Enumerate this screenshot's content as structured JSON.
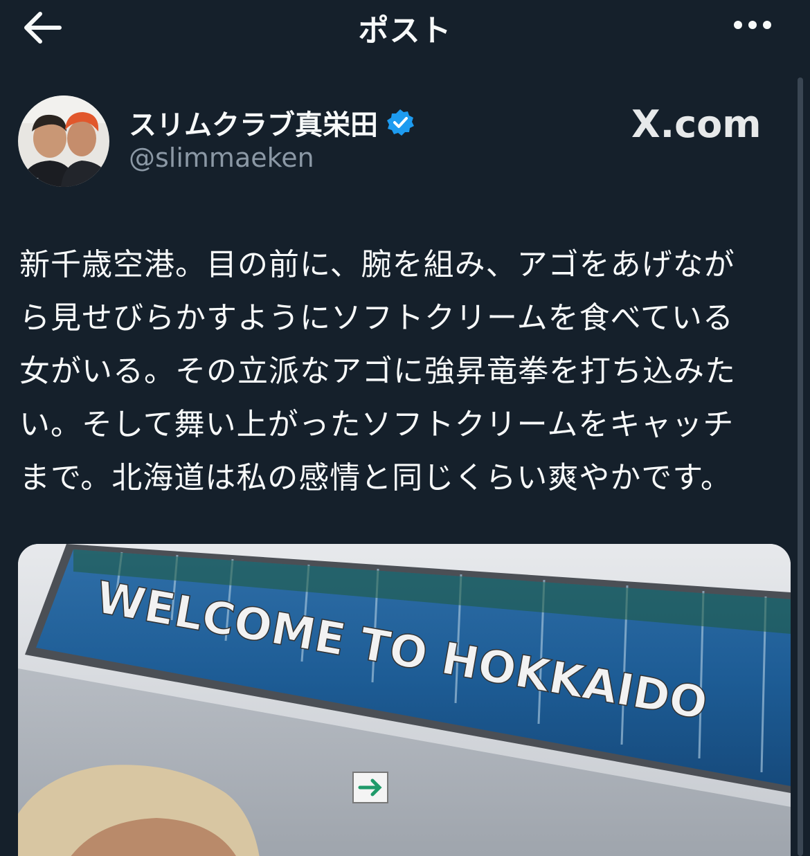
{
  "header": {
    "title": "ポスト",
    "back_icon": "arrow-left-icon",
    "more_icon": "more-horizontal-icon"
  },
  "author": {
    "display_name": "スリムクラブ真栄田",
    "handle": "@slimmaeken",
    "verified": true,
    "verified_color": "#1d9bf0"
  },
  "source_label": "X.com",
  "post": {
    "lines": [
      "新千歳空港。目の前に、腕を組み、アゴをあげなが",
      "ら見せびらかすようにソフトクリームを食べている",
      "女がいる。その立派なアゴに強昇竜拳を打ち込みた",
      "い。そして舞い上がったソフトクリームをキャッチ",
      "まで。北海道は私の感情と同じくらい爽やかです。"
    ]
  },
  "media": {
    "sign_text": "WELCOME TO HOKKAIDO",
    "arrow_icon": "exit-arrow-icon"
  },
  "colors": {
    "background": "#15202b",
    "text": "#f7f9f9",
    "secondary_text": "#8b98a5",
    "accent": "#1d9bf0"
  }
}
